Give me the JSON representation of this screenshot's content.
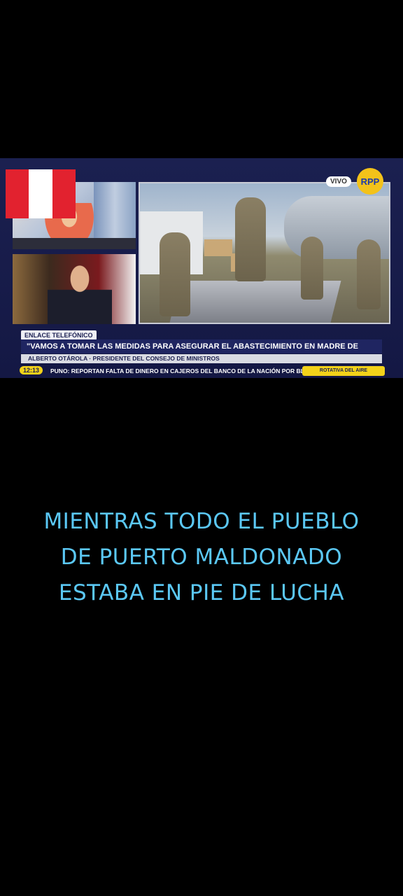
{
  "broadcast": {
    "live_badge": "VIVO",
    "channel_logo": "RPP",
    "segment_tag": "ENLACE TELEFÓNICO",
    "headline": "\"VAMOS A TOMAR LAS MEDIDAS PARA ASEGURAR EL ABASTECIMIENTO EN MADRE DE DIOS\"",
    "speaker": "ALBERTO OTÁROLA · PRESIDENTE DEL CONSEJO DE MINISTROS",
    "ticker_time": "12:13",
    "ticker_text": "PUNO: REPORTAN FALTA DE DINERO EN CAJEROS DEL BANCO DE LA NACIÓN POR BLOQUEOS",
    "ticker_button": "ROTATIVA DEL AIRE"
  },
  "overlay": {
    "flag": "peru-flag-icon",
    "colors": {
      "flag_red": "#e2222f",
      "caption": "#5bc8f5"
    }
  },
  "caption": {
    "line1": "MIENTRAS TODO EL PUEBLO",
    "line2": "DE PUERTO MALDONADO",
    "line3": "ESTABA EN PIE DE LUCHA"
  }
}
